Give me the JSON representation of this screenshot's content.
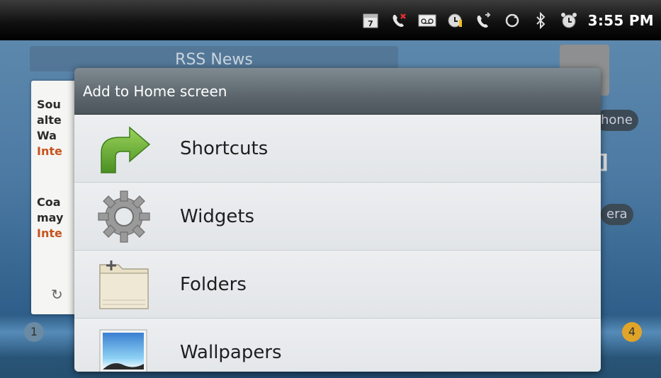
{
  "status_bar": {
    "time": "3:55 PM",
    "calendar_day": "7",
    "icons": [
      "calendar-icon",
      "missed-call-icon",
      "voicemail-icon",
      "alarm-alert-icon",
      "call-forward-icon",
      "sync-icon",
      "bluetooth-icon",
      "alarm-clock-icon"
    ]
  },
  "home": {
    "rss_widget_title": "RSS News",
    "rss_items": [
      {
        "line1": "Sou",
        "line2": "alte",
        "line3": "Wa",
        "source": "Inte"
      },
      {
        "line1": "Coa",
        "line2": "may",
        "source": "Inte"
      }
    ],
    "pill_phone": "hone",
    "pill_camera": "era",
    "page_left": "1",
    "page_right": "4"
  },
  "dialog": {
    "title": "Add to Home screen",
    "items": [
      {
        "label": "Shortcuts",
        "icon": "shortcut-arrow-icon"
      },
      {
        "label": "Widgets",
        "icon": "gear-icon"
      },
      {
        "label": "Folders",
        "icon": "folder-icon"
      },
      {
        "label": "Wallpapers",
        "icon": "wallpaper-icon"
      }
    ]
  },
  "colors": {
    "dialog_title_bg": "#5d666d",
    "dialog_list_bg": "#e6e9ec",
    "shortcut_green": "#6db33f",
    "rss_source_orange": "#c6531e"
  }
}
